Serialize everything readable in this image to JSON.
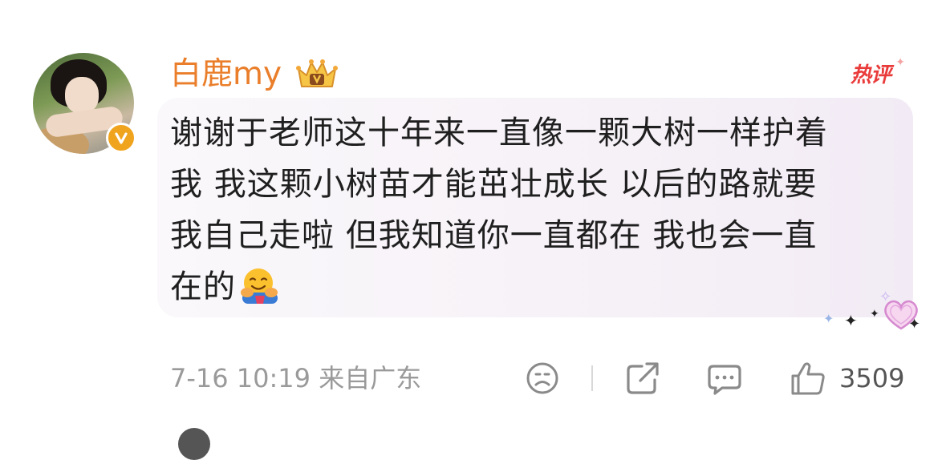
{
  "comment": {
    "username": "白鹿my",
    "badge": "热评",
    "lines": [
      "谢谢于老师这十年来一直像一颗大树一样护着",
      "我 我这颗小树苗才能茁壮成长 以后的路就要",
      "我自己走啦 但我知道你一直都在 我也会一直",
      "在的"
    ],
    "emoji": "hugging-face",
    "timestamp": "7-16 10:19",
    "location": "来自广东",
    "like_count": "3509"
  },
  "colors": {
    "username": "#ea7e2a",
    "hot_badge": "#ea3b3b",
    "verified_badge": "#f0a41e",
    "meta_text": "#9a9a9a",
    "bubble_bg": "#f6f1f7"
  },
  "icons": [
    "vip-crown-icon",
    "verified-v-icon",
    "hugging-face-emoji",
    "heart-sticker-icon",
    "sad-face-icon",
    "share-icon",
    "comment-icon",
    "thumbs-up-icon"
  ]
}
